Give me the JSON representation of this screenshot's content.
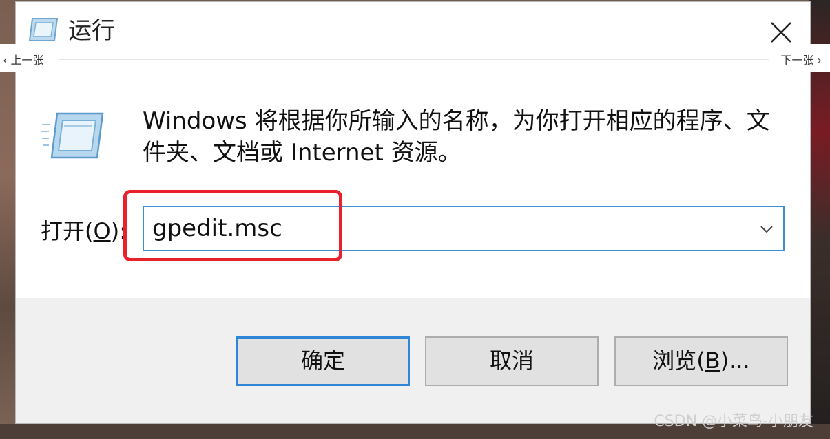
{
  "window": {
    "title": "运行",
    "close_glyph": "✕"
  },
  "nav": {
    "prev": "‹ 上一张",
    "next": "下一张 ›"
  },
  "content": {
    "description": "Windows 将根据你所输入的名称，为你打开相应的程序、文件夹、文档或 Internet 资源。",
    "open_label_prefix": "打开(",
    "open_label_key": "O",
    "open_label_suffix": "):",
    "open_value": "gpedit.msc"
  },
  "buttons": {
    "ok": "确定",
    "cancel": "取消",
    "browse_prefix": "浏览(",
    "browse_key": "B",
    "browse_suffix": ")..."
  },
  "watermark": "CSDN @小菜鸟-小朋友",
  "colors": {
    "accent": "#3c8fd6",
    "highlight": "#e8212c",
    "footer_bg": "#f0f0f0"
  },
  "icons": {
    "title": "run-app-icon",
    "main": "run-app-icon",
    "close": "close-icon",
    "dropdown": "chevron-down-icon"
  }
}
